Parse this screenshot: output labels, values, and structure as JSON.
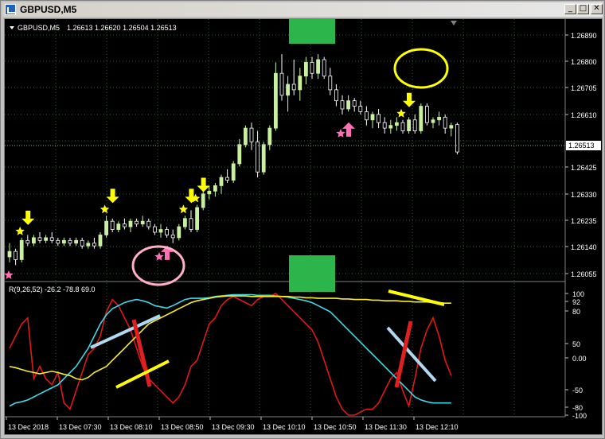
{
  "window": {
    "title": "GBPUSD,M5",
    "controls": {
      "minimize": "_",
      "maximize": "□",
      "close": "✕"
    }
  },
  "chart_header": {
    "symbol": "GBPUSD,M5",
    "ohlc": "1.26613 1.26620 1.26504 1.26513"
  },
  "indicator_header": {
    "text": "R(9,26,52) -26.2 -78.8 69.0"
  },
  "colors": {
    "bull_candle": "#c8f0a0",
    "bear_candle": "#ffffff",
    "grid": "#3a5a3a",
    "buy_arrow": "#ff6fb5",
    "sell_arrow": "#ffff00",
    "marker_box": "#2bb54a",
    "line_red": "#e01818",
    "line_cyan": "#40d8e8",
    "line_yellow": "#f8f020"
  },
  "icons": {
    "sell_signal": "yellow-down-arrow-icon",
    "buy_signal": "pink-up-arrow-icon",
    "star_yellow": "yellow-star-icon",
    "star_pink": "pink-star-icon"
  },
  "price_axis": {
    "ticks": [
      "1.26890",
      "1.26800",
      "1.26705",
      "1.26610",
      "1.26513",
      "1.26425",
      "1.26330",
      "1.26235",
      "1.26140",
      "1.26055"
    ],
    "current_price": "1.26513"
  },
  "indicator_axis": {
    "ticks": [
      "100",
      "92",
      "80",
      "50",
      "0.00",
      "-50",
      "-80",
      "-100"
    ]
  },
  "time_axis": {
    "labels": [
      "13 Dec 2018",
      "13 Dec 07:30",
      "13 Dec 08:10",
      "13 Dec 08:50",
      "13 Dec 09:30",
      "13 Dec 10:10",
      "13 Dec 10:50",
      "13 Dec 11:30",
      "13 Dec 12:10"
    ]
  },
  "chart_data": {
    "type": "candlestick",
    "symbol": "GBPUSD",
    "timeframe": "M5",
    "y_range": [
      1.2604,
      1.2694
    ],
    "candles": [
      [
        1.2613,
        1.2618,
        1.2611,
        1.2615
      ],
      [
        1.2615,
        1.2616,
        1.261,
        1.2612
      ],
      [
        1.2612,
        1.262,
        1.2611,
        1.2619
      ],
      [
        1.2619,
        1.2621,
        1.2617,
        1.2618
      ],
      [
        1.2618,
        1.2621,
        1.2617,
        1.262
      ],
      [
        1.262,
        1.2622,
        1.2618,
        1.2619
      ],
      [
        1.2619,
        1.2621,
        1.2618,
        1.262
      ],
      [
        1.262,
        1.2622,
        1.2618,
        1.2619
      ],
      [
        1.2619,
        1.262,
        1.2617,
        1.2618
      ],
      [
        1.2618,
        1.262,
        1.2617,
        1.2619
      ],
      [
        1.2619,
        1.262,
        1.2617,
        1.2618
      ],
      [
        1.2618,
        1.262,
        1.2617,
        1.2619
      ],
      [
        1.2619,
        1.262,
        1.2616,
        1.2617
      ],
      [
        1.2617,
        1.2619,
        1.2616,
        1.2618
      ],
      [
        1.2618,
        1.262,
        1.2616,
        1.2617
      ],
      [
        1.2617,
        1.2622,
        1.2616,
        1.2621
      ],
      [
        1.2621,
        1.2628,
        1.262,
        1.2626
      ],
      [
        1.2626,
        1.2627,
        1.2622,
        1.2623
      ],
      [
        1.2623,
        1.2626,
        1.2622,
        1.2625
      ],
      [
        1.2625,
        1.2627,
        1.2623,
        1.2624
      ],
      [
        1.2624,
        1.2627,
        1.2622,
        1.2626
      ],
      [
        1.2626,
        1.2627,
        1.2624,
        1.2625
      ],
      [
        1.2625,
        1.2628,
        1.2624,
        1.2626
      ],
      [
        1.2626,
        1.2627,
        1.2623,
        1.2624
      ],
      [
        1.2624,
        1.2625,
        1.2621,
        1.2622
      ],
      [
        1.2622,
        1.2625,
        1.262,
        1.2623
      ],
      [
        1.2623,
        1.2624,
        1.262,
        1.2621
      ],
      [
        1.2621,
        1.2623,
        1.2618,
        1.262
      ],
      [
        1.262,
        1.2625,
        1.2619,
        1.2624
      ],
      [
        1.2624,
        1.2628,
        1.2623,
        1.2627
      ],
      [
        1.2627,
        1.263,
        1.2622,
        1.2623
      ],
      [
        1.2623,
        1.2632,
        1.2622,
        1.2631
      ],
      [
        1.2631,
        1.2638,
        1.263,
        1.2636
      ],
      [
        1.2636,
        1.2639,
        1.2634,
        1.2637
      ],
      [
        1.2637,
        1.264,
        1.2635,
        1.2639
      ],
      [
        1.2639,
        1.2643,
        1.2636,
        1.2642
      ],
      [
        1.2642,
        1.2645,
        1.264,
        1.2641
      ],
      [
        1.2641,
        1.2648,
        1.264,
        1.2647
      ],
      [
        1.2647,
        1.2656,
        1.2646,
        1.2654
      ],
      [
        1.2654,
        1.2661,
        1.2653,
        1.266
      ],
      [
        1.266,
        1.2662,
        1.2652,
        1.2655
      ],
      [
        1.2655,
        1.2659,
        1.2642,
        1.2644
      ],
      [
        1.2644,
        1.2655,
        1.2643,
        1.2654
      ],
      [
        1.2654,
        1.2661,
        1.2652,
        1.266
      ],
      [
        1.266,
        1.2684,
        1.2659,
        1.268
      ],
      [
        1.268,
        1.2687,
        1.267,
        1.2672
      ],
      [
        1.2672,
        1.2679,
        1.2666,
        1.2676
      ],
      [
        1.2676,
        1.2685,
        1.2672,
        1.2674
      ],
      [
        1.2674,
        1.2682,
        1.267,
        1.2679
      ],
      [
        1.2679,
        1.2686,
        1.2676,
        1.2684
      ],
      [
        1.2684,
        1.2686,
        1.2678,
        1.268
      ],
      [
        1.268,
        1.2687,
        1.2678,
        1.2685
      ],
      [
        1.2685,
        1.2686,
        1.2678,
        1.2679
      ],
      [
        1.2679,
        1.2682,
        1.2672,
        1.2674
      ],
      [
        1.2674,
        1.2676,
        1.2668,
        1.267
      ],
      [
        1.267,
        1.2672,
        1.2665,
        1.2667
      ],
      [
        1.2667,
        1.2672,
        1.2666,
        1.267
      ],
      [
        1.267,
        1.2671,
        1.2666,
        1.2668
      ],
      [
        1.2668,
        1.267,
        1.2665,
        1.2666
      ],
      [
        1.2666,
        1.2668,
        1.2661,
        1.2663
      ],
      [
        1.2663,
        1.2666,
        1.266,
        1.2665
      ],
      [
        1.2665,
        1.2667,
        1.266,
        1.2662
      ],
      [
        1.2662,
        1.2664,
        1.2658,
        1.266
      ],
      [
        1.266,
        1.2663,
        1.2658,
        1.2661
      ],
      [
        1.2661,
        1.2664,
        1.2659,
        1.2662
      ],
      [
        1.2662,
        1.2663,
        1.2658,
        1.2659
      ],
      [
        1.2659,
        1.2664,
        1.2658,
        1.2663
      ],
      [
        1.2663,
        1.2665,
        1.2658,
        1.2659
      ],
      [
        1.2659,
        1.2669,
        1.2658,
        1.2668
      ],
      [
        1.2668,
        1.2669,
        1.2661,
        1.2662
      ],
      [
        1.2662,
        1.2664,
        1.266,
        1.2663
      ],
      [
        1.2663,
        1.2666,
        1.2661,
        1.2664
      ],
      [
        1.2664,
        1.2665,
        1.2658,
        1.266
      ],
      [
        1.266,
        1.2662,
        1.2657,
        1.2661
      ],
      [
        1.26613,
        1.2662,
        1.26504,
        1.26513
      ]
    ],
    "sell_signal_candles": [
      2,
      16,
      29,
      31,
      65
    ],
    "buy_signal_candles": [
      25,
      55
    ],
    "indicator": {
      "name": "R(9,26,52)",
      "y_range": [
        -100,
        100
      ],
      "series": [
        {
          "values": [
            10,
            30,
            50,
            60,
            -40,
            -20,
            -40,
            -50,
            -30,
            -80,
            -90,
            -60,
            -30,
            0,
            10,
            30,
            70,
            90,
            80,
            60,
            40,
            10,
            -20,
            -40,
            -50,
            -60,
            -70,
            -80,
            -70,
            -50,
            -20,
            -10,
            20,
            50,
            60,
            80,
            90,
            95,
            90,
            85,
            80,
            90,
            95,
            95,
            100,
            90,
            80,
            70,
            60,
            50,
            40,
            20,
            -10,
            -40,
            -70,
            -90,
            -100,
            -100,
            -95,
            -90,
            -90,
            -80,
            -60,
            -40,
            -30,
            -60,
            -85,
            -40,
            10,
            40,
            60,
            30,
            -10,
            -35
          ]
        },
        {
          "values": [
            -85,
            -80,
            -78,
            -75,
            -70,
            -65,
            -60,
            -55,
            -50,
            -40,
            -30,
            -20,
            -5,
            10,
            30,
            50,
            65,
            75,
            80,
            85,
            88,
            90,
            88,
            85,
            80,
            78,
            76,
            80,
            85,
            90,
            92,
            92,
            92,
            93,
            95,
            96,
            97,
            98,
            98,
            98,
            98,
            97,
            97,
            97,
            96,
            95,
            94,
            92,
            90,
            88,
            85,
            80,
            75,
            70,
            60,
            50,
            40,
            30,
            20,
            10,
            0,
            -10,
            -20,
            -30,
            -40,
            -50,
            -60,
            -70,
            -75,
            -78,
            -80,
            -80,
            -80,
            -80
          ]
        },
        {
          "values": [
            -20,
            -22,
            -25,
            -28,
            -30,
            -32,
            -30,
            -28,
            -30,
            -33,
            -35,
            -40,
            -42,
            -38,
            -30,
            -25,
            -20,
            -10,
            0,
            10,
            20,
            30,
            40,
            50,
            55,
            60,
            65,
            70,
            75,
            80,
            85,
            88,
            90,
            92,
            94,
            95,
            96,
            96,
            96,
            96,
            95,
            95,
            95,
            95,
            95,
            95,
            95,
            94,
            94,
            93,
            93,
            92,
            92,
            92,
            92,
            91,
            91,
            90,
            90,
            90,
            89,
            89,
            88,
            88,
            88,
            87,
            87,
            86,
            86,
            86,
            85,
            85,
            84,
            84
          ]
        }
      ]
    }
  }
}
